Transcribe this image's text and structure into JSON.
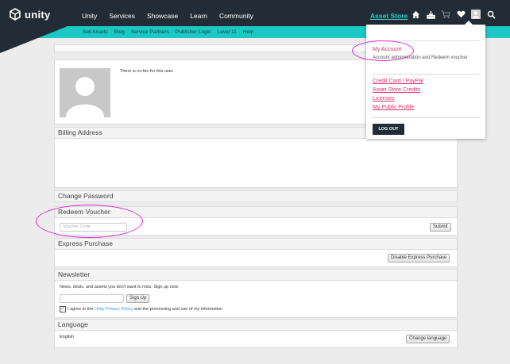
{
  "brand": {
    "name": "unity"
  },
  "nav": {
    "items": [
      "Unity",
      "Services",
      "Showcase",
      "Learn",
      "Community"
    ],
    "asset_store": "Asset Store"
  },
  "icons": [
    "home-icon",
    "downloads-icon",
    "cart-icon",
    "heart-icon",
    "user-icon",
    "search-icon"
  ],
  "subnav": {
    "items": [
      "Sell Assets",
      "Blog",
      "Service Partners",
      "Publisher Login",
      "Level 11",
      "Help"
    ]
  },
  "profile": {
    "bio": "There is no bio for this user."
  },
  "billing": {
    "title": "Billing Address"
  },
  "password": {
    "title": "Change Password"
  },
  "voucher": {
    "title": "Redeem Voucher",
    "placeholder": "Voucher Code",
    "submit": "Submit"
  },
  "express": {
    "title": "Express Purchase",
    "button": "Disable Express Purchase"
  },
  "newsletter": {
    "title": "Newsletter",
    "description": "News, deals, and assets you don't want to miss. Sign up now.",
    "signup": "Sign Up",
    "agree_prefix": "I agree to the ",
    "agree_link": "Unity Privacy Policy",
    "agree_suffix": " and the processing and use of my information"
  },
  "language": {
    "title": "Language",
    "value": "English",
    "button": "Change language"
  },
  "dropdown": {
    "my_account": "My Account",
    "my_account_desc": "Account administration and Redeem voucher",
    "links": [
      "Credit Card / PayPal",
      "Asset Store Credits",
      "Licenses",
      "My Public Profile"
    ],
    "logout": "LOG OUT"
  },
  "colors": {
    "nav_bg": "#222c37",
    "subnav_bg": "#1cc8c3",
    "link_pink": "#e0306b",
    "highlight": "#e02ad6"
  }
}
